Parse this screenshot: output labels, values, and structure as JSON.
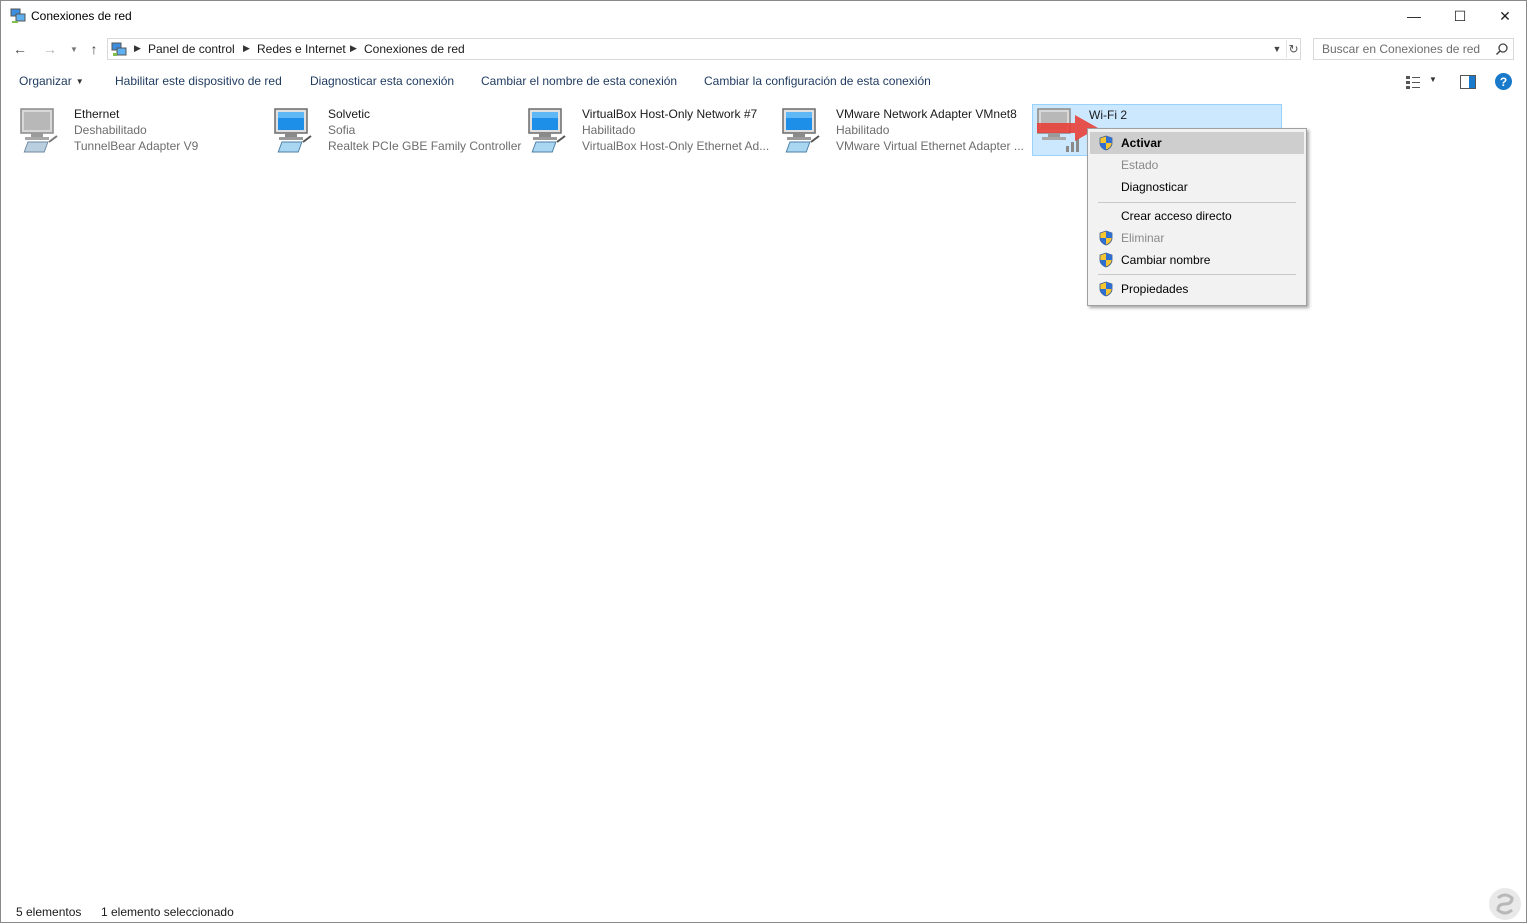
{
  "window": {
    "title": "Conexiones de red",
    "controls": {
      "minimize": "—",
      "maximize": "☐",
      "close": "✕"
    }
  },
  "nav": {
    "back": "←",
    "forward": "→",
    "history": "▼",
    "up": "↑",
    "breadcrumb": [
      "Panel de control",
      "Redes e Internet",
      "Conexiones de red"
    ],
    "dropdown": "▼",
    "refresh": "↻",
    "search_placeholder": "Buscar en Conexiones de red"
  },
  "commands": {
    "organize": "Organizar",
    "enable": "Habilitar este dispositivo de red",
    "diagnose": "Diagnosticar esta conexión",
    "rename": "Cambiar el nombre de esta conexión",
    "change_settings": "Cambiar la configuración de esta conexión",
    "help": "?"
  },
  "connections": [
    {
      "name": "Ethernet",
      "status": "Deshabilitado",
      "adapter": "TunnelBear Adapter V9",
      "icon": "network-adapter-disabled-icon"
    },
    {
      "name": "Solvetic",
      "status": "Sofia",
      "adapter": "Realtek PCIe GBE Family Controller",
      "icon": "network-adapter-icon"
    },
    {
      "name": "VirtualBox Host-Only Network #7",
      "status": "Habilitado",
      "adapter": "VirtualBox Host-Only Ethernet Ad...",
      "icon": "network-adapter-icon"
    },
    {
      "name": "VMware Network Adapter VMnet8",
      "status": "Habilitado",
      "adapter": "VMware Virtual Ethernet Adapter ...",
      "icon": "network-adapter-icon"
    },
    {
      "name": "Wi-Fi 2",
      "status": "",
      "adapter": "",
      "icon": "wifi-adapter-disabled-icon",
      "selected": true
    }
  ],
  "context_menu": {
    "items": [
      {
        "label": "Activar",
        "shield": true,
        "bold": true,
        "hover": true,
        "disabled": false
      },
      {
        "label": "Estado",
        "shield": false,
        "disabled": true
      },
      {
        "label": "Diagnosticar",
        "shield": false,
        "disabled": false
      },
      {
        "label": "Crear acceso directo",
        "shield": false,
        "disabled": false
      },
      {
        "label": "Eliminar",
        "shield": true,
        "disabled": true
      },
      {
        "label": "Cambiar nombre",
        "shield": true,
        "disabled": false
      },
      {
        "label": "Propiedades",
        "shield": true,
        "disabled": false
      }
    ]
  },
  "statusbar": {
    "count": "5 elementos",
    "selection": "1 elemento seleccionado"
  },
  "colors": {
    "selection_bg": "#cce8ff",
    "selection_border": "#99d1ff",
    "menu_bg": "#f2f2f2",
    "menu_hover": "#cecece",
    "arrow": "#e8413a"
  }
}
